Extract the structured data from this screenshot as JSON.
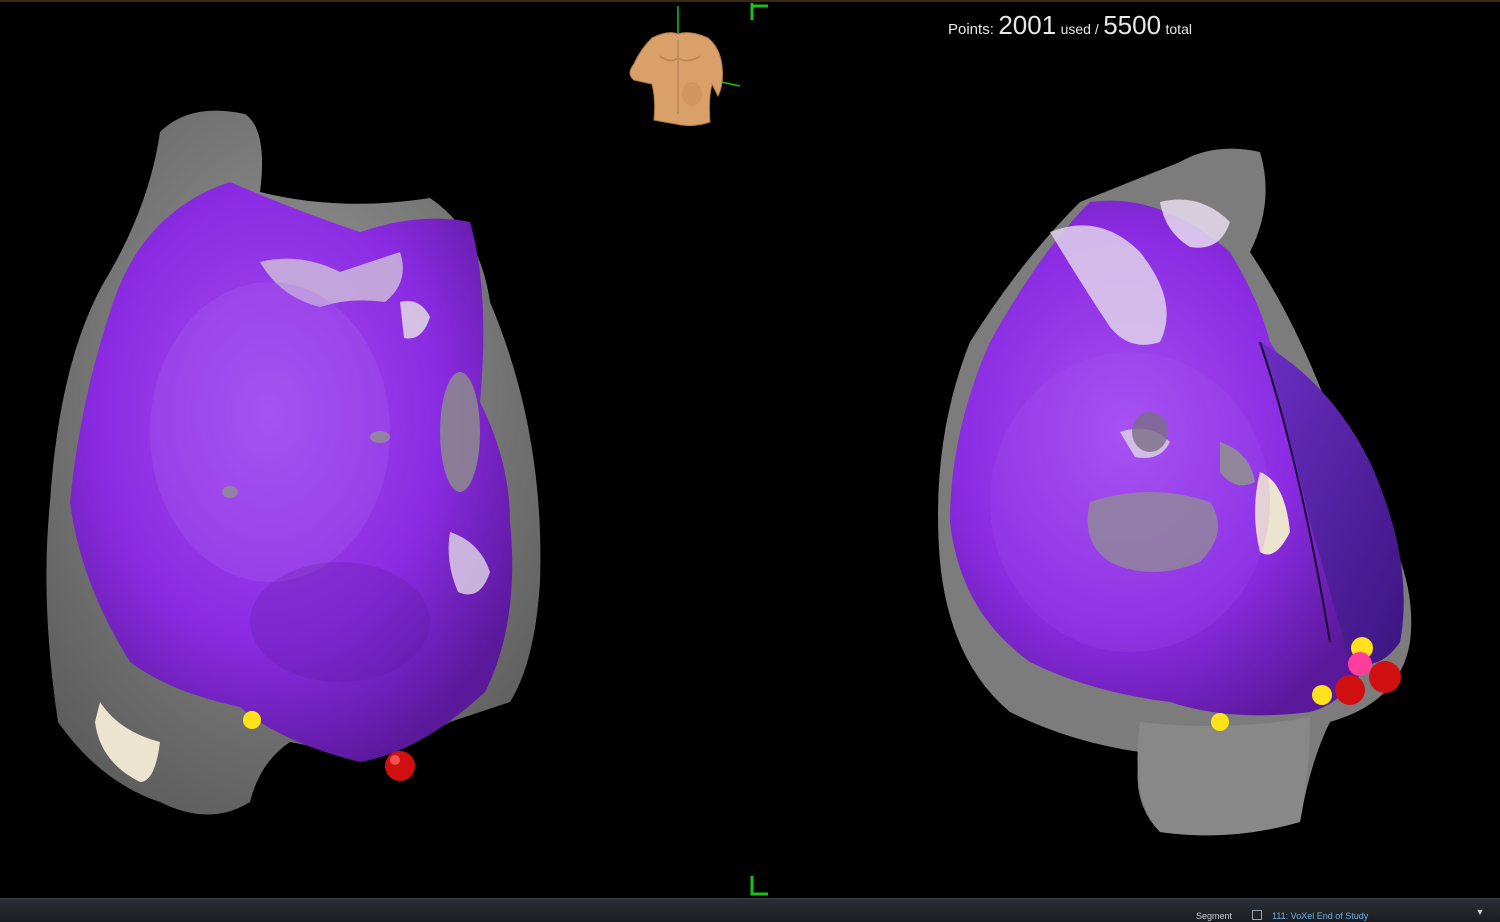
{
  "readout": {
    "prefix": "Points:",
    "used_value": "2001",
    "used_label": "used /",
    "total_value": "5500",
    "total_label": "total"
  },
  "status_bar": {
    "segment_label": "Segment",
    "segment_value": "111: VoXel End of Study",
    "dropdown_glyph": "▼"
  },
  "icons": {
    "orientation": "torso-orientation-icon",
    "segment": "segment-icon",
    "dropdown": "chevron-down-icon"
  },
  "colors": {
    "background": "#000000",
    "map_purple": "#8a2be2",
    "tissue_gray": "#8c8c8c",
    "highlight": "#ede4cf",
    "marker_red": "#d01010",
    "marker_yellow": "#ffe21a",
    "marker_pink": "#ff3d9a",
    "crosshair_green": "#18c018",
    "torso": "#d9a06a"
  }
}
